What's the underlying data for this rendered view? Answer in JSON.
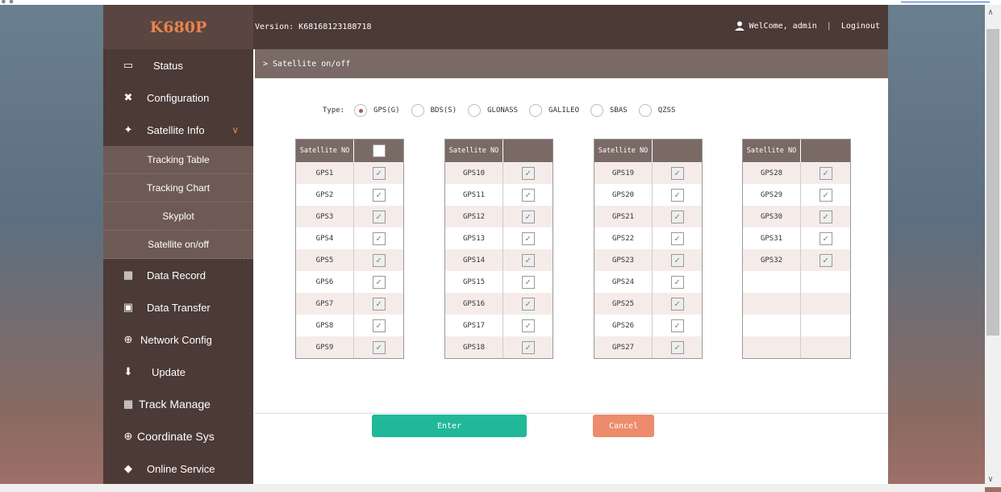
{
  "app": {
    "logo": "K680P",
    "version": "Version: K68168123188718",
    "user_greeting": "WelCome, admin",
    "separator": "|",
    "logout": "Loginout"
  },
  "sidebar": {
    "items": [
      {
        "label": "Status",
        "icon": "monitor-icon"
      },
      {
        "label": "Configuration",
        "icon": "tools-icon"
      },
      {
        "label": "Satellite Info",
        "icon": "satellite-icon",
        "expanded": true
      }
    ],
    "sub_items": [
      {
        "label": "Tracking Table"
      },
      {
        "label": "Tracking Chart"
      },
      {
        "label": "Skyplot"
      },
      {
        "label": "Satellite on/off",
        "active": true
      }
    ],
    "items_after": [
      {
        "label": "Data Record",
        "icon": "calendar-icon"
      },
      {
        "label": "Data Transfer",
        "icon": "network-icon"
      },
      {
        "label": "Network Config",
        "icon": "globe-icon"
      },
      {
        "label": "Update",
        "icon": "upload-icon"
      },
      {
        "label": "Track Manage",
        "icon": "calendar-icon"
      },
      {
        "label": "Coordinate Sys",
        "icon": "globe-icon"
      },
      {
        "label": "Online Service",
        "icon": "service-icon"
      }
    ]
  },
  "breadcrumb": "> Satellite on/off",
  "type": {
    "label": "Type:",
    "options": [
      "GPS(G)",
      "BDS(S)",
      "GLONASS",
      "GALILEO",
      "SBAS",
      "QZSS"
    ],
    "selected": "GPS(G)"
  },
  "table_header": "Satellite NO",
  "tables": [
    [
      "GPS1",
      "GPS2",
      "GPS3",
      "GPS4",
      "GPS5",
      "GPS6",
      "GPS7",
      "GPS8",
      "GPS9"
    ],
    [
      "GPS10",
      "GPS11",
      "GPS12",
      "GPS13",
      "GPS14",
      "GPS15",
      "GPS16",
      "GPS17",
      "GPS18"
    ],
    [
      "GPS19",
      "GPS20",
      "GPS21",
      "GPS22",
      "GPS23",
      "GPS24",
      "GPS25",
      "GPS26",
      "GPS27"
    ],
    [
      "GPS28",
      "GPS29",
      "GPS30",
      "GPS31",
      "GPS32",
      "",
      "",
      "",
      ""
    ]
  ],
  "buttons": {
    "enter": "Enter",
    "cancel": "Cancel"
  },
  "colors": {
    "accent": "#e8844c",
    "enter": "#21b89a",
    "cancel": "#ec8c6c",
    "sidebar": "#4b3a36"
  }
}
